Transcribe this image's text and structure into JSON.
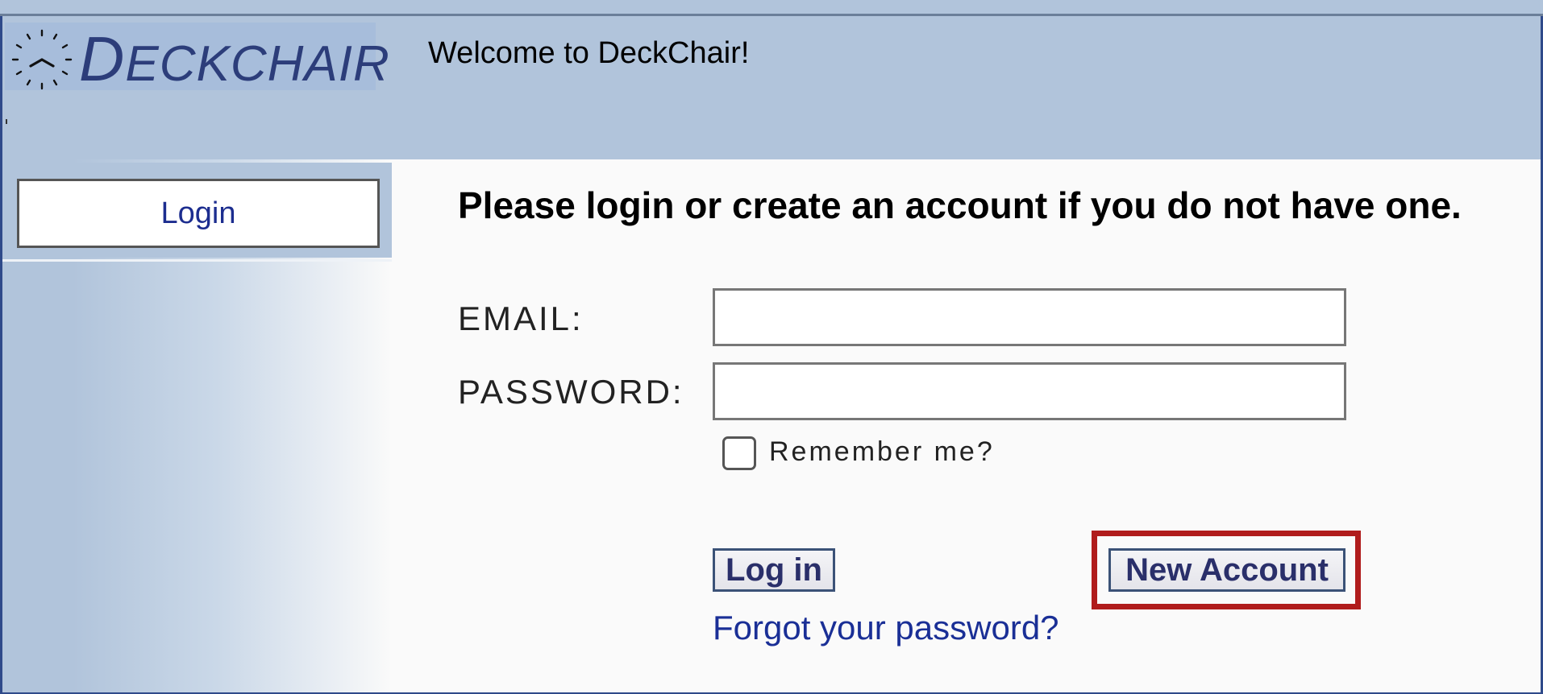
{
  "header": {
    "logo_text": "DECKCHAIR",
    "welcome": "Welcome to DeckChair!"
  },
  "sidebar": {
    "login_label": "Login"
  },
  "main": {
    "title": "Please login or create an account if you do not have one.",
    "email_label": "EMAIL:",
    "email_value": "",
    "password_label": "PASSWORD:",
    "password_value": "",
    "remember_label": "Remember me?",
    "remember_checked": false,
    "login_button": "Log in",
    "new_account_button": "New Account",
    "forgot_link": "Forgot your password?"
  },
  "colors": {
    "header_bg": "#b1c4db",
    "link": "#1a2f96",
    "highlight": "#b01c1c",
    "logo": "#2c3d7a"
  },
  "icons": {
    "logo": "clock-icon"
  }
}
